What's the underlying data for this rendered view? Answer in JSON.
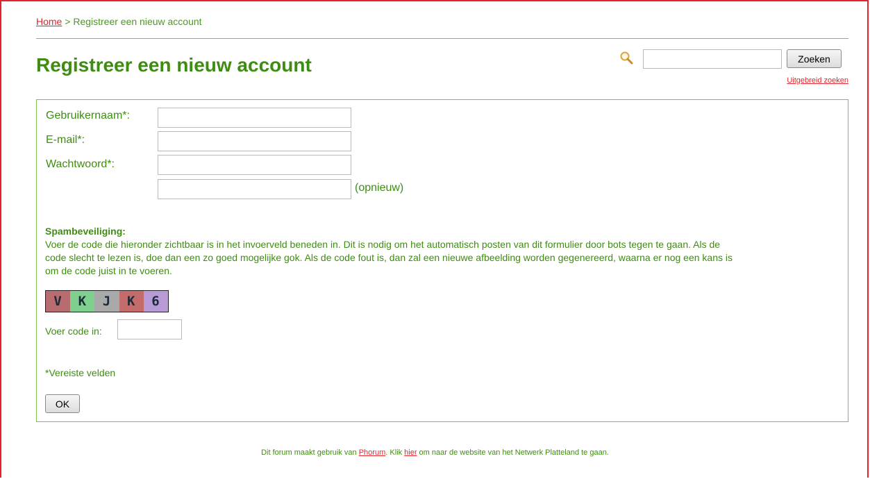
{
  "breadcrumb": {
    "home": "Home",
    "separator": " > ",
    "current": "Registreer een nieuw account"
  },
  "page_title": "Registreer een nieuw account",
  "search": {
    "button_label": "Zoeken",
    "value": "",
    "advanced_link": "Uitgebreid zoeken"
  },
  "form": {
    "username_label": "Gebruikernaam*:",
    "email_label": "E-mail*:",
    "password_label": "Wachtwoord*:",
    "password_again_note": "(opnieuw)",
    "spam_title": "Spambeveiliging:",
    "spam_text": "Voer de code die hieronder zichtbaar is in het invoerveld beneden in. Dit is nodig om het automatisch posten van dit formulier door bots tegen te gaan. Als de code slecht te lezen is, doe dan een zo goed mogelijke gok. Als de code fout is, dan zal een nieuwe afbeelding worden gegenereerd, waarna er nog een kans is om de code juist in te voeren.",
    "captcha_chars": [
      "V",
      "K",
      "J",
      "K",
      "6"
    ],
    "captcha_colors": [
      "#b96c6f",
      "#7fcf8f",
      "#a9a9a9",
      "#c46b6b",
      "#b79ad6"
    ],
    "code_label": "Voer code in:",
    "required_note": "*Vereiste velden",
    "submit_label": "OK"
  },
  "footer": {
    "prefix": "Dit forum maakt gebruik van ",
    "phorum_link": "Phorum",
    "middle": ". Klik ",
    "here_link": "hier",
    "suffix": " om naar de website van het Netwerk Platteland te gaan."
  },
  "colors": {
    "accent_green": "#3f8c12",
    "link_red": "#e3242b",
    "border_green": "#7cbf4b"
  }
}
